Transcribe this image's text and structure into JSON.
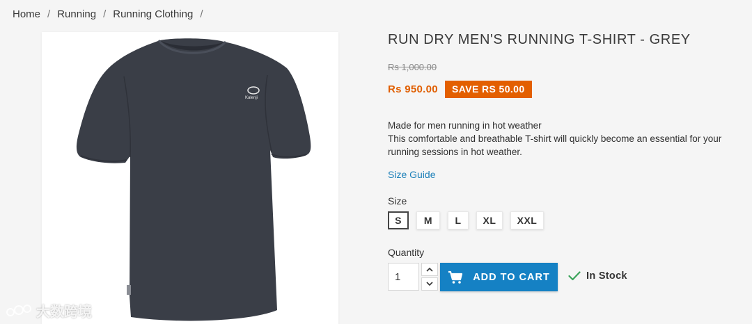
{
  "breadcrumb": {
    "items": [
      "Home",
      "Running",
      "Running Clothing"
    ],
    "separator": "/"
  },
  "product": {
    "title": "RUN DRY MEN'S RUNNING T-SHIRT - GREY",
    "old_price": "Rs 1,000.00",
    "price": "Rs 950.00",
    "save_badge": "SAVE RS 50.00",
    "description_line1": "Made for men running in hot weather",
    "description_line2": "This comfortable and breathable T-shirt will quickly become an essential for your running sessions in hot weather.",
    "size_guide_label": "Size Guide",
    "size_label": "Size",
    "sizes": [
      "S",
      "M",
      "L",
      "XL",
      "XXL"
    ],
    "selected_size": "S",
    "quantity_label": "Quantity",
    "quantity_value": "1",
    "add_to_cart_label": "ADD TO CART",
    "stock_status": "In Stock",
    "image_logo_text": "Kalenji"
  },
  "watermark": {
    "text": "大数跨境"
  },
  "colors": {
    "accent_orange": "#e35f00",
    "primary_blue": "#1581c4",
    "link_blue": "#1a7fb8",
    "stock_green": "#3aa35a",
    "shirt_grey": "#3a3e47"
  },
  "icons": {
    "cart": "cart-icon",
    "check": "check-icon",
    "qty_up": "chevron-up-icon",
    "qty_down": "chevron-down-icon"
  }
}
